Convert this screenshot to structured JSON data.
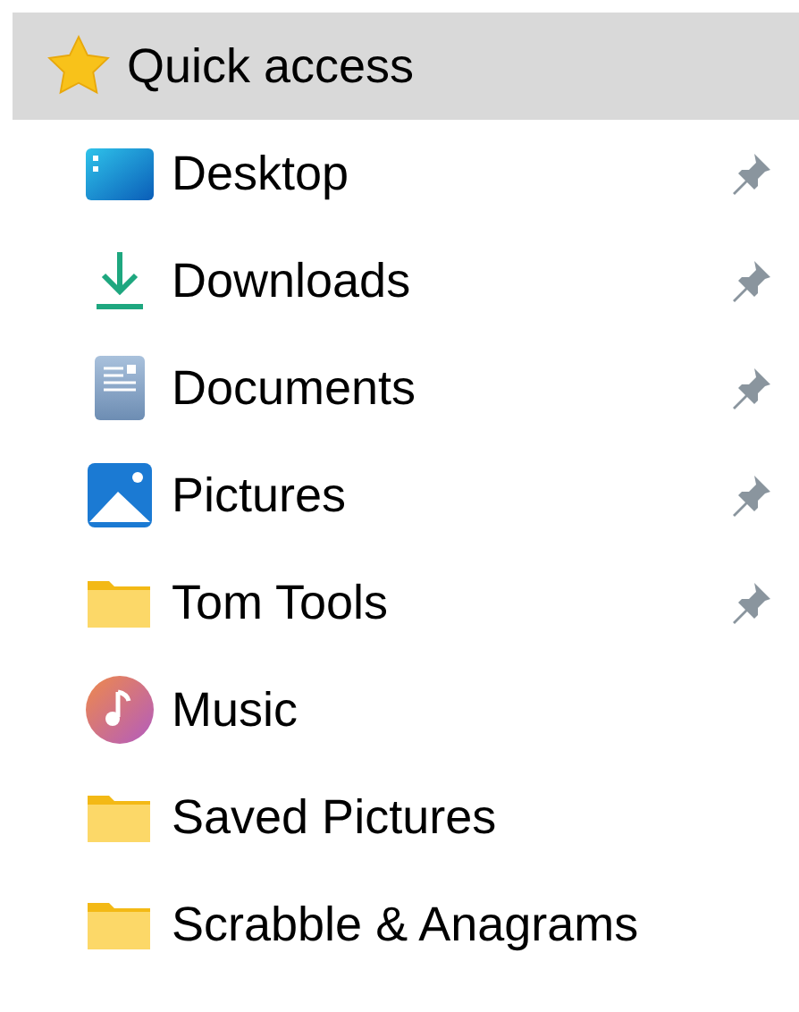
{
  "quick_access": {
    "label": "Quick access",
    "selected": true
  },
  "items": [
    {
      "label": "Desktop",
      "kind": "desktop",
      "pinned": true,
      "selected": false
    },
    {
      "label": "Downloads",
      "kind": "downloads",
      "pinned": true,
      "selected": false
    },
    {
      "label": "Documents",
      "kind": "documents",
      "pinned": true,
      "selected": false
    },
    {
      "label": "Pictures",
      "kind": "pictures",
      "pinned": true,
      "selected": false
    },
    {
      "label": "Tom Tools",
      "kind": "folder",
      "pinned": true,
      "selected": false
    },
    {
      "label": "Music",
      "kind": "music",
      "pinned": false,
      "selected": false
    },
    {
      "label": "Saved Pictures",
      "kind": "folder",
      "pinned": false,
      "selected": false
    },
    {
      "label": "Scrabble & Anagrams",
      "kind": "folder",
      "pinned": false,
      "selected": false
    }
  ]
}
